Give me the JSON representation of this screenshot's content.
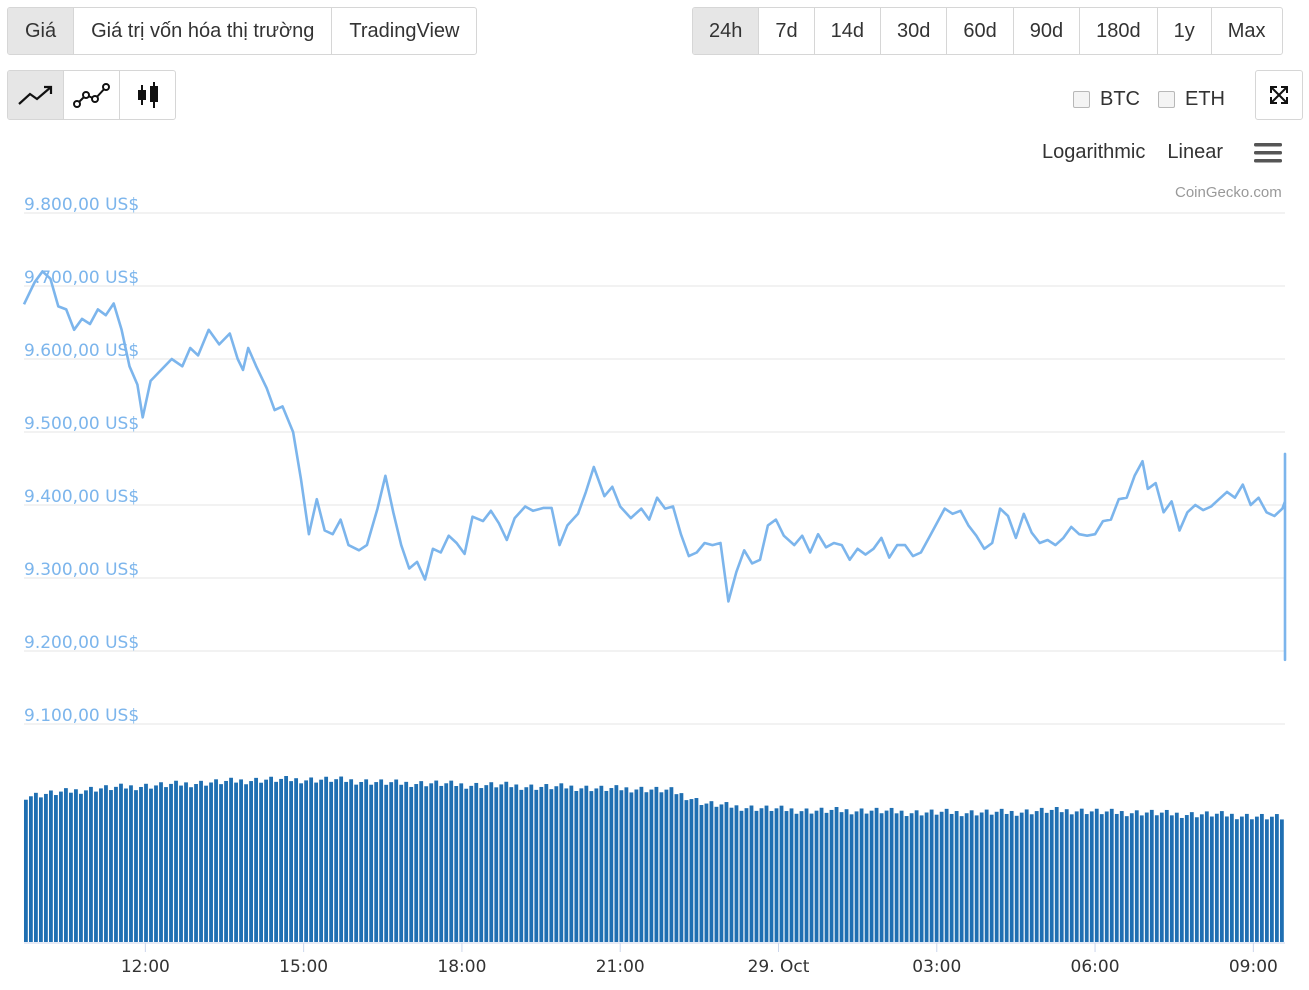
{
  "tabs": [
    "Giá",
    "Giá trị vốn hóa thị trường",
    "TradingView"
  ],
  "active_tab": 0,
  "ranges": [
    "24h",
    "7d",
    "14d",
    "30d",
    "60d",
    "90d",
    "180d",
    "1y",
    "Max"
  ],
  "active_range": 0,
  "chart_type_icons": [
    "line-chart-icon",
    "line-markers-chart-icon",
    "candlestick-chart-icon"
  ],
  "compare": {
    "btc": "BTC",
    "eth": "ETH"
  },
  "scales": {
    "log": "Logarithmic",
    "linear": "Linear"
  },
  "credit": "CoinGecko.com",
  "colors": {
    "price_line": "#7cb5ec",
    "volume": "#1f6fb2",
    "grid": "#e6e6e6",
    "y_labels": "#7cb5ec"
  },
  "chart_data": {
    "type": "line",
    "ylim": [
      9100,
      9800
    ],
    "y_ticks": [
      "9.800,00 US$",
      "9.700,00 US$",
      "9.600,00 US$",
      "9.500,00 US$",
      "9.400,00 US$",
      "9.300,00 US$",
      "9.200,00 US$",
      "9.100,00 US$"
    ],
    "y_tick_values": [
      9800,
      9700,
      9600,
      9500,
      9400,
      9300,
      9200,
      9100
    ],
    "x_ticks": [
      "12:00",
      "15:00",
      "18:00",
      "21:00",
      "29. Oct",
      "03:00",
      "06:00",
      "09:00"
    ],
    "x_tick_hours": [
      12,
      15,
      18,
      21,
      24,
      27,
      30,
      33
    ],
    "x_start_hour": 9.7,
    "x_end_hour": 33.6,
    "price": [
      [
        9.7,
        9675
      ],
      [
        9.9,
        9705
      ],
      [
        10.05,
        9720
      ],
      [
        10.2,
        9710
      ],
      [
        10.35,
        9672
      ],
      [
        10.5,
        9668
      ],
      [
        10.65,
        9640
      ],
      [
        10.8,
        9655
      ],
      [
        10.95,
        9648
      ],
      [
        11.1,
        9668
      ],
      [
        11.25,
        9660
      ],
      [
        11.4,
        9676
      ],
      [
        11.55,
        9640
      ],
      [
        11.7,
        9590
      ],
      [
        11.85,
        9565
      ],
      [
        11.95,
        9520
      ],
      [
        12.1,
        9570
      ],
      [
        12.3,
        9585
      ],
      [
        12.5,
        9600
      ],
      [
        12.7,
        9590
      ],
      [
        12.85,
        9615
      ],
      [
        13.0,
        9605
      ],
      [
        13.2,
        9640
      ],
      [
        13.4,
        9620
      ],
      [
        13.6,
        9635
      ],
      [
        13.75,
        9600
      ],
      [
        13.85,
        9585
      ],
      [
        13.95,
        9615
      ],
      [
        14.1,
        9590
      ],
      [
        14.3,
        9560
      ],
      [
        14.45,
        9530
      ],
      [
        14.6,
        9535
      ],
      [
        14.8,
        9500
      ],
      [
        14.95,
        9435
      ],
      [
        15.1,
        9360
      ],
      [
        15.25,
        9408
      ],
      [
        15.4,
        9365
      ],
      [
        15.55,
        9360
      ],
      [
        15.7,
        9380
      ],
      [
        15.85,
        9345
      ],
      [
        16.05,
        9338
      ],
      [
        16.2,
        9345
      ],
      [
        16.4,
        9395
      ],
      [
        16.55,
        9440
      ],
      [
        16.7,
        9390
      ],
      [
        16.85,
        9345
      ],
      [
        17.0,
        9313
      ],
      [
        17.15,
        9322
      ],
      [
        17.3,
        9298
      ],
      [
        17.45,
        9340
      ],
      [
        17.6,
        9335
      ],
      [
        17.75,
        9358
      ],
      [
        17.9,
        9348
      ],
      [
        18.05,
        9333
      ],
      [
        18.2,
        9384
      ],
      [
        18.4,
        9378
      ],
      [
        18.55,
        9392
      ],
      [
        18.7,
        9375
      ],
      [
        18.85,
        9352
      ],
      [
        19.0,
        9382
      ],
      [
        19.2,
        9398
      ],
      [
        19.35,
        9392
      ],
      [
        19.55,
        9396
      ],
      [
        19.7,
        9396
      ],
      [
        19.85,
        9345
      ],
      [
        20.0,
        9372
      ],
      [
        20.2,
        9388
      ],
      [
        20.35,
        9418
      ],
      [
        20.5,
        9452
      ],
      [
        20.7,
        9412
      ],
      [
        20.85,
        9425
      ],
      [
        21.0,
        9398
      ],
      [
        21.2,
        9382
      ],
      [
        21.4,
        9395
      ],
      [
        21.55,
        9380
      ],
      [
        21.7,
        9410
      ],
      [
        21.85,
        9395
      ],
      [
        22.0,
        9398
      ],
      [
        22.15,
        9360
      ],
      [
        22.3,
        9330
      ],
      [
        22.45,
        9335
      ],
      [
        22.6,
        9348
      ],
      [
        22.75,
        9345
      ],
      [
        22.9,
        9348
      ],
      [
        23.05,
        9268
      ],
      [
        23.2,
        9308
      ],
      [
        23.35,
        9338
      ],
      [
        23.5,
        9320
      ],
      [
        23.65,
        9325
      ],
      [
        23.8,
        9372
      ],
      [
        23.95,
        9380
      ],
      [
        24.1,
        9358
      ],
      [
        24.3,
        9345
      ],
      [
        24.45,
        9358
      ],
      [
        24.6,
        9335
      ],
      [
        24.75,
        9360
      ],
      [
        24.9,
        9342
      ],
      [
        25.05,
        9348
      ],
      [
        25.2,
        9345
      ],
      [
        25.35,
        9325
      ],
      [
        25.5,
        9340
      ],
      [
        25.65,
        9332
      ],
      [
        25.8,
        9340
      ],
      [
        25.95,
        9355
      ],
      [
        26.1,
        9328
      ],
      [
        26.25,
        9345
      ],
      [
        26.4,
        9345
      ],
      [
        26.55,
        9330
      ],
      [
        26.7,
        9335
      ],
      [
        26.85,
        9355
      ],
      [
        27.0,
        9375
      ],
      [
        27.15,
        9395
      ],
      [
        27.3,
        9388
      ],
      [
        27.45,
        9392
      ],
      [
        27.6,
        9372
      ],
      [
        27.75,
        9358
      ],
      [
        27.9,
        9340
      ],
      [
        28.05,
        9348
      ],
      [
        28.2,
        9395
      ],
      [
        28.35,
        9385
      ],
      [
        28.5,
        9355
      ],
      [
        28.65,
        9388
      ],
      [
        28.8,
        9362
      ],
      [
        28.95,
        9348
      ],
      [
        29.1,
        9352
      ],
      [
        29.25,
        9345
      ],
      [
        29.4,
        9355
      ],
      [
        29.55,
        9370
      ],
      [
        29.7,
        9360
      ],
      [
        29.85,
        9358
      ],
      [
        30.0,
        9360
      ],
      [
        30.15,
        9378
      ],
      [
        30.3,
        9380
      ],
      [
        30.45,
        9408
      ],
      [
        30.6,
        9410
      ],
      [
        30.75,
        9440
      ],
      [
        30.9,
        9460
      ],
      [
        31.0,
        9422
      ],
      [
        31.15,
        9430
      ],
      [
        31.3,
        9390
      ],
      [
        31.45,
        9405
      ],
      [
        31.6,
        9365
      ],
      [
        31.75,
        9390
      ],
      [
        31.9,
        9400
      ],
      [
        32.05,
        9393
      ],
      [
        32.2,
        9398
      ],
      [
        32.35,
        9408
      ],
      [
        32.5,
        9418
      ],
      [
        32.65,
        9410
      ],
      [
        32.8,
        9428
      ],
      [
        32.95,
        9400
      ],
      [
        33.1,
        9410
      ],
      [
        33.25,
        9390
      ],
      [
        33.4,
        9385
      ],
      [
        33.55,
        9395
      ],
      [
        33.7,
        9405
      ],
      [
        33.85,
        9410
      ],
      [
        34.0,
        9425
      ],
      [
        34.15,
        9410
      ],
      [
        34.3,
        9440
      ],
      [
        34.45,
        9455
      ],
      [
        34.6,
        9470
      ],
      [
        34.75,
        9425
      ],
      [
        34.9,
        9410
      ],
      [
        35.05,
        9438
      ],
      [
        35.2,
        9458
      ],
      [
        35.35,
        9458
      ],
      [
        35.5,
        9465
      ],
      [
        35.65,
        9450
      ],
      [
        35.8,
        9462
      ],
      [
        35.95,
        9422
      ],
      [
        36.1,
        9408
      ],
      [
        36.25,
        9410
      ],
      [
        36.4,
        9430
      ],
      [
        36.55,
        9450
      ],
      [
        36.7,
        9442
      ],
      [
        36.85,
        9452
      ],
      [
        37.0,
        9448
      ],
      [
        37.15,
        9450
      ],
      [
        37.3,
        9438
      ],
      [
        37.45,
        9460
      ],
      [
        37.6,
        9452
      ],
      [
        37.75,
        9460
      ],
      [
        37.9,
        9462
      ],
      [
        38.05,
        9470
      ],
      [
        38.15,
        9435
      ],
      [
        38.3,
        9298
      ],
      [
        38.45,
        9188
      ],
      [
        38.6,
        9265
      ],
      [
        38.75,
        9238
      ],
      [
        38.9,
        9240
      ],
      [
        39.05,
        9238
      ],
      [
        39.2,
        9258
      ],
      [
        39.35,
        9255
      ],
      [
        39.5,
        9262
      ],
      [
        39.65,
        9282
      ],
      [
        39.8,
        9290
      ],
      [
        39.95,
        9298
      ],
      [
        40.1,
        9285
      ],
      [
        40.25,
        9270
      ],
      [
        40.4,
        9285
      ],
      [
        40.55,
        9285
      ],
      [
        40.7,
        9265
      ],
      [
        40.85,
        9268
      ],
      [
        41.0,
        9260
      ],
      [
        41.15,
        9250
      ],
      [
        41.3,
        9245
      ],
      [
        41.45,
        9262
      ],
      [
        41.6,
        9255
      ],
      [
        41.75,
        9290
      ],
      [
        41.9,
        9252
      ],
      [
        42.05,
        9298
      ],
      [
        42.2,
        9295
      ],
      [
        42.35,
        9275
      ],
      [
        42.5,
        9320
      ],
      [
        42.65,
        9295
      ],
      [
        42.8,
        9295
      ],
      [
        42.95,
        9288
      ],
      [
        43.1,
        9270
      ],
      [
        43.25,
        9298
      ],
      [
        43.4,
        9280
      ],
      [
        43.55,
        9260
      ]
    ],
    "volume_levels": [
      0.8,
      0.82,
      0.84,
      0.85,
      0.86,
      0.87,
      0.88,
      0.89,
      0.89,
      0.89,
      0.88,
      0.87,
      0.87,
      0.86,
      0.86,
      0.85,
      0.85,
      0.84,
      0.84,
      0.83,
      0.76,
      0.74,
      0.73,
      0.72,
      0.72,
      0.72,
      0.71,
      0.71,
      0.71,
      0.71,
      0.72,
      0.72,
      0.71,
      0.71,
      0.7,
      0.7,
      0.69,
      0.68
    ]
  }
}
